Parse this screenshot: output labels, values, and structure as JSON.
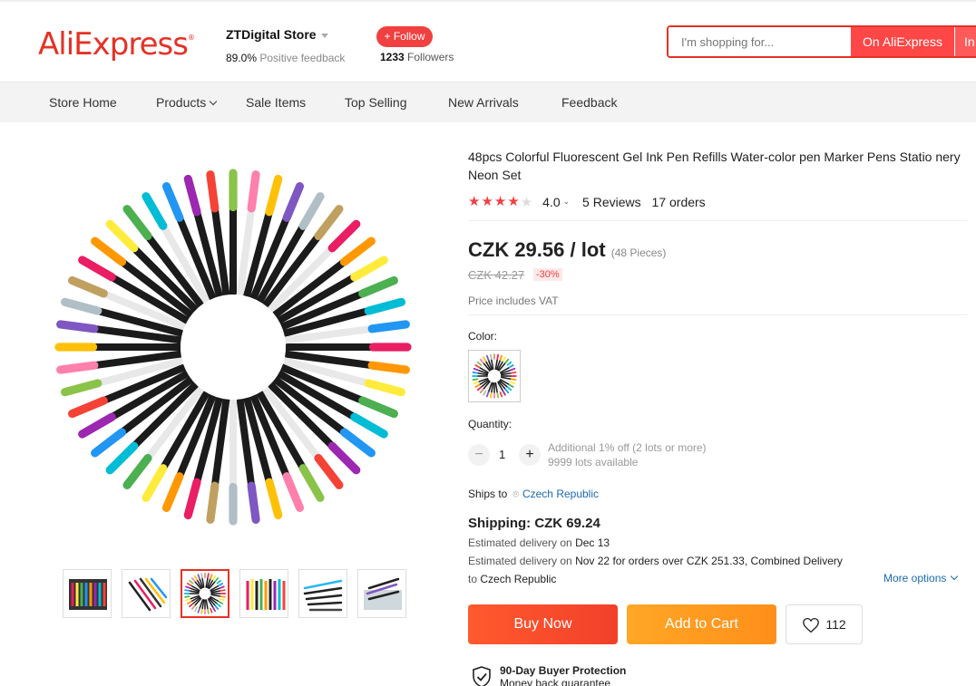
{
  "brand": {
    "logo_text": "AliExpress"
  },
  "store": {
    "name": "ZTDigital Store",
    "feedback_pct": "89.0%",
    "feedback_label": "Positive feedback",
    "follow_label": "+ Follow",
    "followers_count": "1233",
    "followers_label": "Followers"
  },
  "search": {
    "placeholder": "I'm shopping for...",
    "on_aliexpress_label": "On AliExpress",
    "in_store_label": "In"
  },
  "nav": {
    "items": [
      {
        "label": "Store Home"
      },
      {
        "label": "Products"
      },
      {
        "label": "Sale Items"
      },
      {
        "label": "Top Selling"
      },
      {
        "label": "New Arrivals"
      },
      {
        "label": "Feedback"
      }
    ]
  },
  "product": {
    "title": "48pcs Colorful Fluorescent Gel Ink Pen Refills Water-color pen Marker Pens Statio nery Neon Set",
    "rating_value": "4.0",
    "rating_stars": 4,
    "reviews": "5 Reviews",
    "orders": "17 orders",
    "price": "CZK 29.56 / lot",
    "pieces": "(48 Pieces)",
    "old_price": "CZK 42.27",
    "discount": "-30%",
    "vat_note": "Price includes VAT",
    "color_label": "Color:",
    "quantity_label": "Quantity:",
    "quantity_value": "1",
    "qty_note_1": "Additional 1% off (2 lots or more)",
    "qty_note_2": "9999 lots available",
    "ships_to_label": "Ships to",
    "ships_to_country": "Czech Republic",
    "shipping": "Shipping: CZK 69.24",
    "delivery_1_prefix": "Estimated delivery on",
    "delivery_1_date": "Dec 13",
    "delivery_2_prefix": "Estimated delivery on",
    "delivery_2_date": "Nov 22",
    "delivery_2_suffix": "for orders over CZK 251.33, Combined Delivery",
    "delivery_3_prefix": "to",
    "delivery_3_country": "Czech Republic",
    "more_options": "More options",
    "buy_now": "Buy Now",
    "add_to_cart": "Add to Cart",
    "wishlist_count": "112",
    "protection_title": "90-Day Buyer Protection",
    "protection_sub": "Money back guarantee"
  },
  "colors": {
    "accent": "#e43225",
    "buy_now": "#f2402a",
    "add_to_cart": "#ff9a1f",
    "link": "#1a6ab1"
  }
}
